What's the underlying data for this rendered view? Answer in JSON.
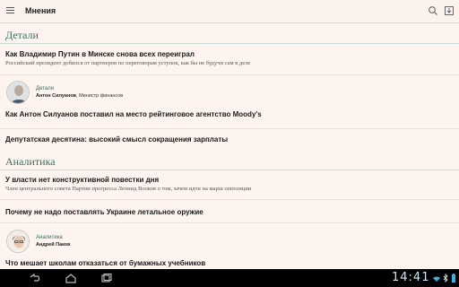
{
  "app": {
    "title": "Мнения"
  },
  "sections": [
    {
      "label": "Детали"
    },
    {
      "label": "Аналитика"
    }
  ],
  "articles": [
    {
      "headline": "Как Владимир Путин в Минске снова всех переиграл",
      "lead": "Российский президент добился от партнеров по переговорам уступок, как бы не будучи сам в деле"
    },
    {
      "headline": "Как Антон Силуанов поставил на место рейтинговое агентство Moody's",
      "author": {
        "rubric": "Детали",
        "name": "Антон Силуанов",
        "role": ", Министр финансов"
      }
    },
    {
      "headline": "Депутатская десятина: высокий смысл сокращения зарплаты"
    },
    {
      "headline": "У власти нет конструктивной повестки дня",
      "lead": "Член центрального совета Партии прогресса Леонид Волков о том, зачем идти на марш оппозиции"
    },
    {
      "headline": "Почему не надо поставлять Украине летальное оружие"
    },
    {
      "headline": "Что мешает школам отказаться от бумажных учебников",
      "author": {
        "rubric": "Аналитика",
        "name": "Андрей Паков"
      }
    }
  ],
  "status_bar": {
    "time": "14:41"
  },
  "colors": {
    "background": "#fdf4ef",
    "accent": "#3a6f63",
    "navbar": "#000000",
    "clock": "#cfe9f4"
  }
}
